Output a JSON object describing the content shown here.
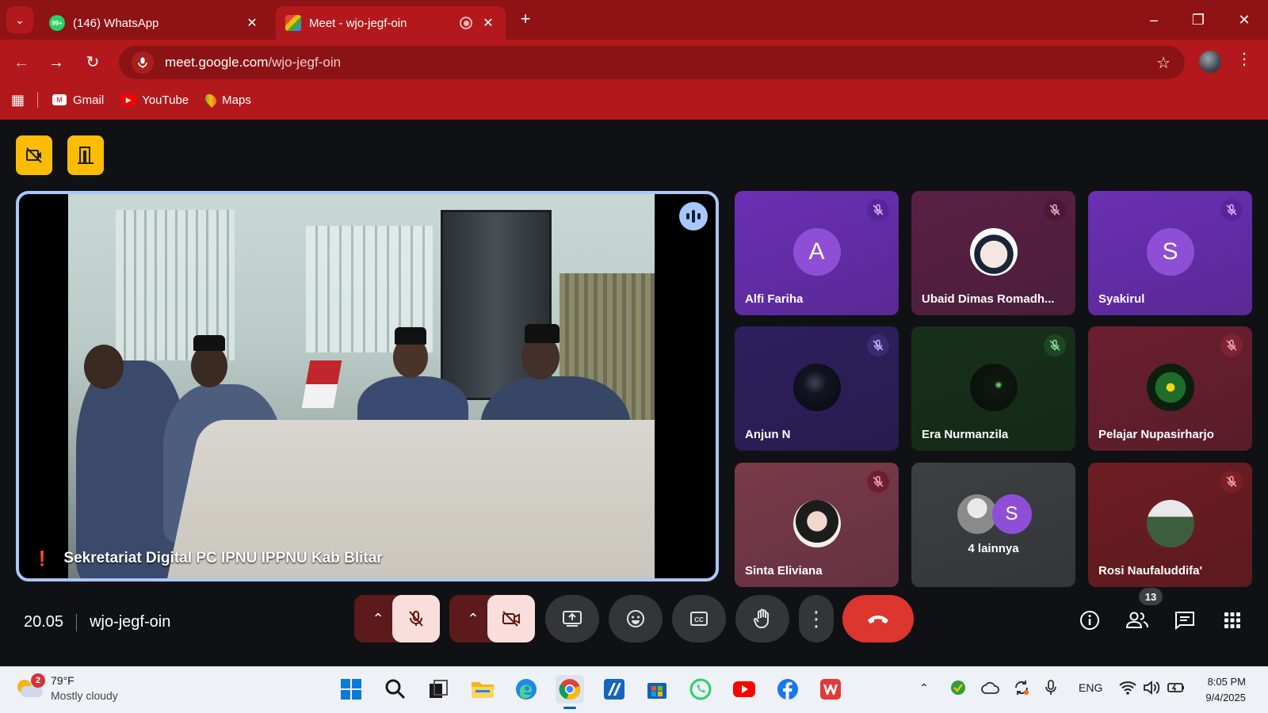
{
  "browser": {
    "tabs": [
      {
        "title": "(146) WhatsApp",
        "favicon": "whatsapp-icon",
        "badge": "99+"
      },
      {
        "title": "Meet - wjo-jegf-oin",
        "favicon": "google-meet-icon"
      }
    ],
    "url_host": "meet.google.com",
    "url_path": "/wjo-jegf-oin",
    "bookmarks": [
      {
        "label": "Gmail",
        "icon": "gmail-icon"
      },
      {
        "label": "YouTube",
        "icon": "youtube-icon"
      },
      {
        "label": "Maps",
        "icon": "maps-icon"
      }
    ],
    "accent": "#b3191c"
  },
  "meet": {
    "featured": {
      "name": "Sekretariat Digital PC IPNU IPPNU Kab Blitar"
    },
    "participants": [
      {
        "name": "Alfi Fariha",
        "initial": "A",
        "bg": "#6b2fb5",
        "avatar_bg": "#8e4fd6",
        "mute_bg": "#57249a"
      },
      {
        "name": "Ubaid Dimas Romadh...",
        "initial": "",
        "bg": "#5a2045",
        "avatar_bg": "#ffffff",
        "mute_bg": "#4a1838"
      },
      {
        "name": "Syakirul",
        "initial": "S",
        "bg": "#6b2fb5",
        "avatar_bg": "#8e4fd6",
        "mute_bg": "#57249a"
      },
      {
        "name": "Anjun N",
        "initial": "",
        "bg": "#2e1f5e",
        "avatar_bg": "#0d0f18",
        "mute_bg": "#3a2a72"
      },
      {
        "name": "Era Nurmanzila",
        "initial": "",
        "bg": "#16301a",
        "avatar_bg": "#0a120b",
        "mute_bg": "#1f4624"
      },
      {
        "name": "Pelajar Nupasirharjo",
        "initial": "",
        "bg": "#6b1f2f",
        "avatar_bg": "#0f2d13",
        "mute_bg": "#7e2236"
      },
      {
        "name": "Sinta Eliviana",
        "initial": "",
        "bg": "#7a3a4a",
        "avatar_bg": "#e8d9d4",
        "mute_bg": "#6b1f2f"
      },
      {
        "name": "4 lainnya",
        "initial": "S",
        "bg": "#3c4043",
        "avatar_bg": "#8e4fd6",
        "mute_bg": ""
      },
      {
        "name": "Rosi Naufaluddifa'",
        "initial": "",
        "bg": "#6e1d22",
        "avatar_bg": "#4d6a4e",
        "mute_bg": "#7c1e24"
      }
    ],
    "time": "20.05",
    "meeting_code": "wjo-jegf-oin",
    "people_count": "13"
  },
  "taskbar": {
    "weather_badge": "2",
    "temp": "79°F",
    "weather": "Mostly cloudy",
    "lang": "ENG",
    "time": "8:05 PM",
    "date": "9/4/2025"
  }
}
